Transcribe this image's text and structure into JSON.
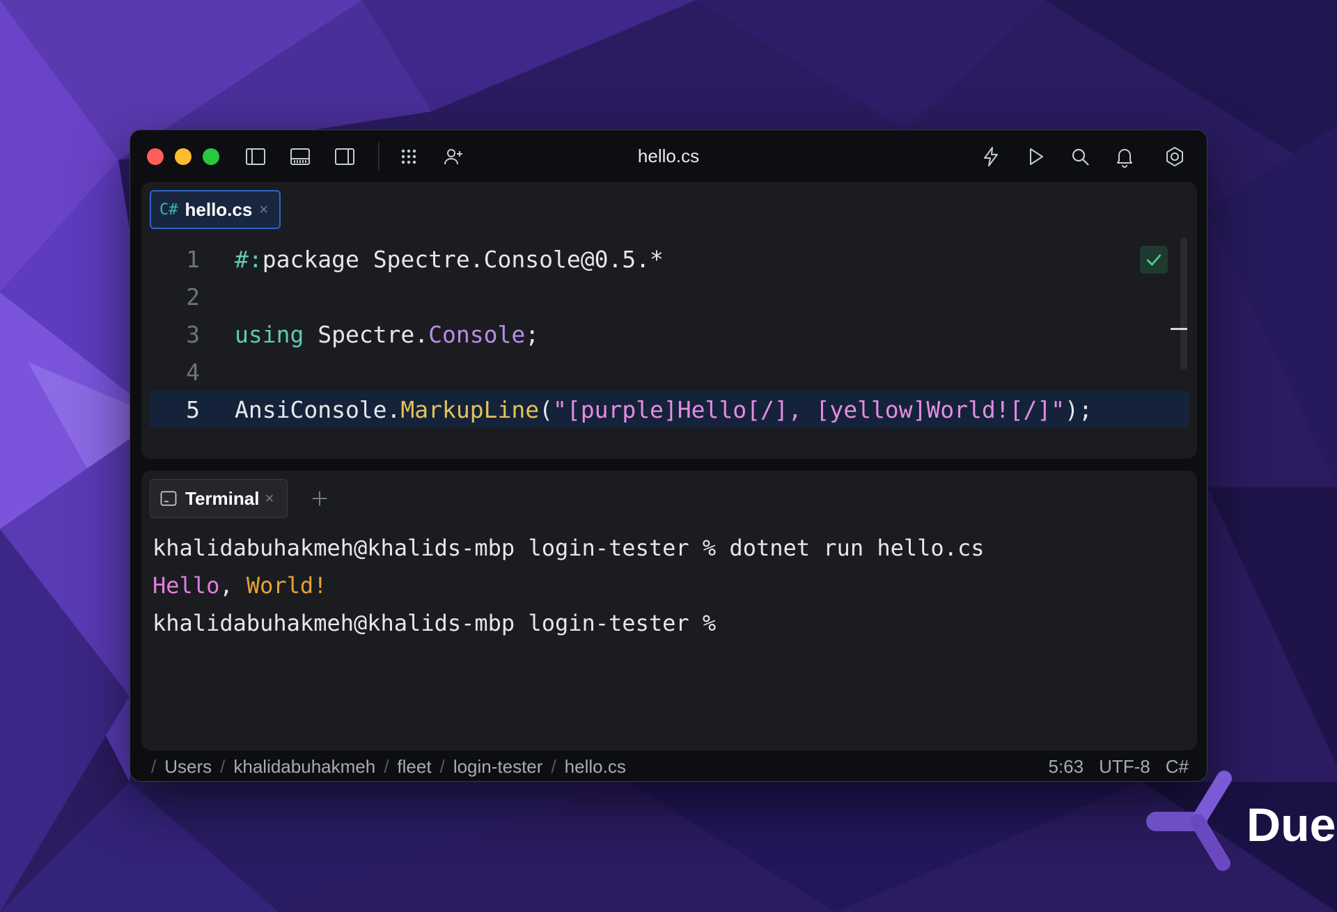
{
  "window": {
    "title": "hello.cs"
  },
  "editor": {
    "tab": {
      "lang": "C#",
      "name": "hello.cs",
      "close": "×"
    },
    "lines": [
      {
        "num": "1",
        "parts": [
          {
            "t": "#:",
            "c": "teal"
          },
          {
            "t": "package Spectre.Console@0.5.*",
            "c": "white"
          }
        ]
      },
      {
        "num": "2",
        "parts": []
      },
      {
        "num": "3",
        "parts": [
          {
            "t": "using",
            "c": "teal"
          },
          {
            "t": " Spectre.",
            "c": "white"
          },
          {
            "t": "Console",
            "c": "purple"
          },
          {
            "t": ";",
            "c": "white"
          }
        ]
      },
      {
        "num": "4",
        "parts": []
      },
      {
        "num": "5",
        "parts": [
          {
            "t": "AnsiConsole.",
            "c": "white"
          },
          {
            "t": "MarkupLine",
            "c": "yellow"
          },
          {
            "t": "(",
            "c": "white"
          },
          {
            "t": "\"[purple]Hello[/], [yellow]World![/]\"",
            "c": "pink"
          },
          {
            "t": ");",
            "c": "white"
          }
        ]
      }
    ],
    "active_line": 5
  },
  "terminal": {
    "tab": {
      "name": "Terminal",
      "close": "×"
    },
    "lines": [
      [
        {
          "t": "khalidabuhakmeh@khalids-mbp login-tester % dotnet run hello.cs",
          "c": "white"
        }
      ],
      [
        {
          "t": "Hello",
          "c": "pink"
        },
        {
          "t": ", ",
          "c": "white"
        },
        {
          "t": "World!",
          "c": "orange"
        }
      ],
      [
        {
          "t": "khalidabuhakmeh@khalids-mbp login-tester %",
          "c": "white"
        }
      ]
    ]
  },
  "status": {
    "breadcrumbs": [
      "Users",
      "khalidabuhakmeh",
      "fleet",
      "login-tester",
      "hello.cs"
    ],
    "position": "5:63",
    "encoding": "UTF-8",
    "language": "C#"
  },
  "logo": {
    "text": "Due"
  },
  "colors": {
    "accent": "#2d64c9",
    "teal": "#5fc9b6",
    "purple": "#b98ce8",
    "yellow": "#e5c158",
    "pink": "#e58ce3",
    "orange": "#e7a23a"
  }
}
